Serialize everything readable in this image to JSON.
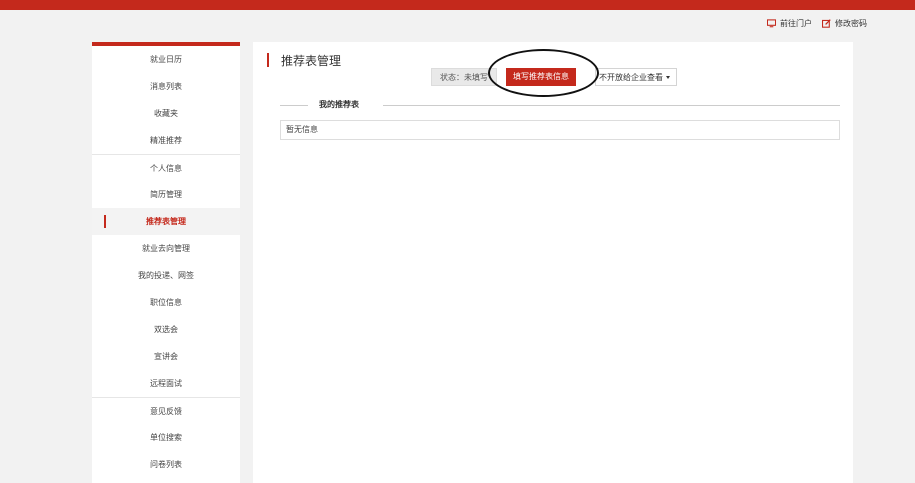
{
  "header": {
    "links": [
      {
        "label": "前往门户",
        "icon": "monitor-icon"
      },
      {
        "label": "修改密码",
        "icon": "edit-icon"
      }
    ],
    "accent": "#c4291c"
  },
  "sidebar": {
    "items": [
      {
        "label": "就业日历"
      },
      {
        "label": "消息列表"
      },
      {
        "label": "收藏夹"
      },
      {
        "label": "精准推荐"
      },
      {
        "label": "个人信息"
      },
      {
        "label": "简历管理"
      },
      {
        "label": "推荐表管理",
        "active": true
      },
      {
        "label": "就业去向管理"
      },
      {
        "label": "我的投递、网签"
      },
      {
        "label": "职位信息"
      },
      {
        "label": "双选会"
      },
      {
        "label": "宣讲会"
      },
      {
        "label": "远程面试"
      },
      {
        "label": "意见反馈"
      },
      {
        "label": "单位搜索"
      },
      {
        "label": "问卷列表"
      }
    ]
  },
  "main": {
    "title": "推荐表管理",
    "status_text": "状态：未填写",
    "fill_button": "填写推荐表信息",
    "open_dropdown": "不开放给企业查看",
    "section_title": "我的推荐表",
    "empty_message": "暂无信息"
  }
}
